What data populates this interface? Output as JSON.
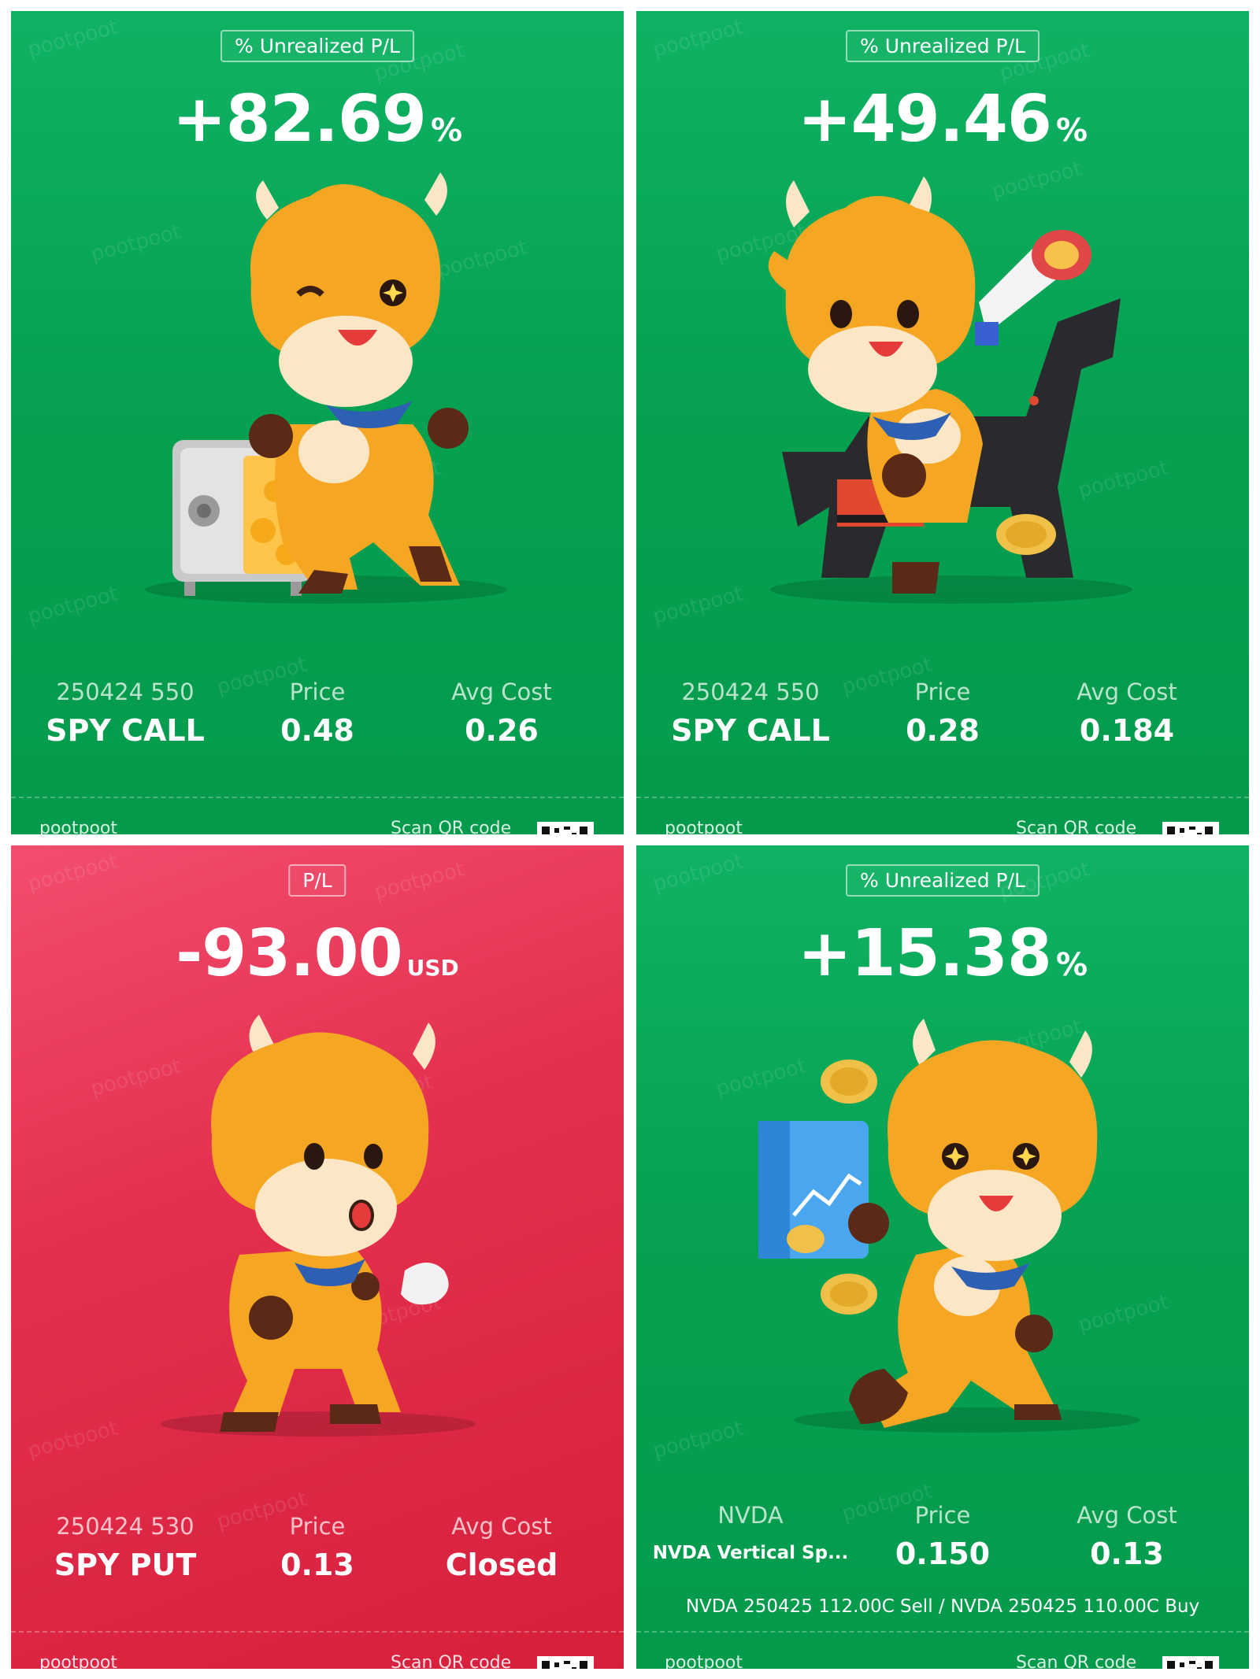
{
  "watermark": "pootpoot",
  "cards": [
    {
      "theme": "green",
      "badge": "% Unrealized P/L",
      "value": "+82.69",
      "unit": "%",
      "mascot": "bull-safe",
      "col1_label": "250424 550",
      "col1_value": "SPY CALL",
      "price_label": "Price",
      "price_value": "0.48",
      "avg_label": "Avg Cost",
      "avg_value": "0.26",
      "footer_left": "pootpoot",
      "footer_right": "Scan QR code"
    },
    {
      "theme": "green",
      "badge": "% Unrealized P/L",
      "value": "+49.46",
      "unit": "%",
      "mascot": "bull-megaphone-horse",
      "col1_label": "250424 550",
      "col1_value": "SPY CALL",
      "price_label": "Price",
      "price_value": "0.28",
      "avg_label": "Avg Cost",
      "avg_value": "0.184",
      "footer_left": "pootpoot",
      "footer_right": "Scan QR code"
    },
    {
      "theme": "red",
      "badge": "P/L",
      "value": "-93.00",
      "unit": "USD",
      "mascot": "bull-sigh",
      "col1_label": "250424 530",
      "col1_value": "SPY PUT",
      "price_label": "Price",
      "price_value": "0.13",
      "avg_label": "Avg Cost",
      "avg_value": "Closed",
      "footer_left": "pootpoot",
      "footer_right": "Scan QR code"
    },
    {
      "theme": "green",
      "badge": "% Unrealized P/L",
      "value": "+15.38",
      "unit": "%",
      "mascot": "bull-chart-coins",
      "col1_label": "NVDA",
      "col1_value": "NVDA  Vertical Sp...",
      "price_label": "Price",
      "price_value": "0.150",
      "avg_label": "Avg Cost",
      "avg_value": "0.13",
      "legs": "NVDA 250425 112.00C Sell / NVDA 250425 110.00C Buy",
      "footer_left": "pootpoot",
      "footer_right": "Scan QR code"
    }
  ],
  "colors": {
    "green": "#06a152",
    "red": "#e4304f",
    "bull_body": "#f5a623",
    "bull_face": "#fbe6c6",
    "scarf": "#2d5fb3"
  }
}
